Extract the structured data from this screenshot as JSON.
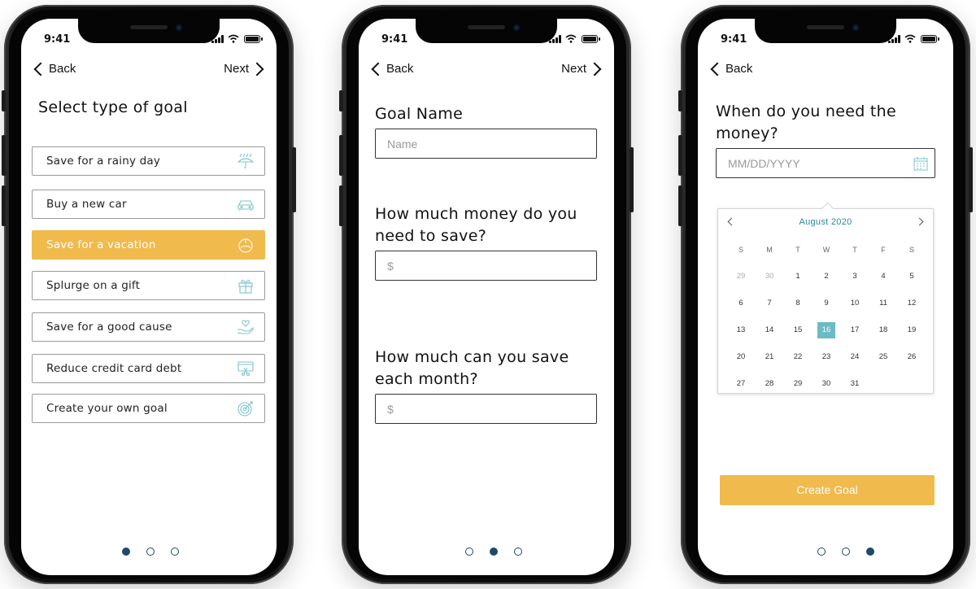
{
  "status": {
    "time": "9:41"
  },
  "nav": {
    "back": "Back",
    "next": "Next"
  },
  "screen1": {
    "title": "Select type of goal",
    "goals": [
      {
        "label": "Save for a rainy day",
        "icon": "umbrella-rain-icon",
        "selected": false
      },
      {
        "label": "Buy a new car",
        "icon": "car-icon",
        "selected": false
      },
      {
        "label": "Save for a vacation",
        "icon": "beach-globe-icon",
        "selected": true
      },
      {
        "label": "Splurge on a gift",
        "icon": "gift-icon",
        "selected": false
      },
      {
        "label": "Save for a good cause",
        "icon": "heart-hand-icon",
        "selected": false
      },
      {
        "label": "Reduce credit card debt",
        "icon": "credit-card-scissors-icon",
        "selected": false
      },
      {
        "label": "Create your own goal",
        "icon": "target-icon",
        "selected": false
      }
    ],
    "page": 1
  },
  "screen2": {
    "goal_name_label": "Goal Name",
    "goal_name_placeholder": "Name",
    "save_total_label": "How much money do you need to save?",
    "save_total_placeholder": "$",
    "monthly_label": "How much can you save each month?",
    "monthly_placeholder": "$",
    "page": 2
  },
  "screen3": {
    "question": "When do you need the money?",
    "date_placeholder": "MM/DD/YYYY",
    "calendar": {
      "month": "August 2020",
      "weekdays": [
        "S",
        "M",
        "T",
        "W",
        "T",
        "F",
        "S"
      ],
      "weeks": [
        [
          "29",
          "30",
          "1",
          "2",
          "3",
          "4",
          "5"
        ],
        [
          "6",
          "7",
          "8",
          "9",
          "10",
          "11",
          "12"
        ],
        [
          "13",
          "14",
          "15",
          "16",
          "17",
          "18",
          "19"
        ],
        [
          "20",
          "21",
          "22",
          "23",
          "24",
          "25",
          "26"
        ],
        [
          "27",
          "28",
          "29",
          "30",
          "31",
          "",
          ""
        ]
      ],
      "selected_day": "16"
    },
    "create_button": "Create Goal",
    "page": 3
  },
  "colors": {
    "accent_yellow": "#f0ba4d",
    "teal": "#6cbac3",
    "dot_navy": "#1d4a6a",
    "icon_teal": "#7ec4cc"
  }
}
